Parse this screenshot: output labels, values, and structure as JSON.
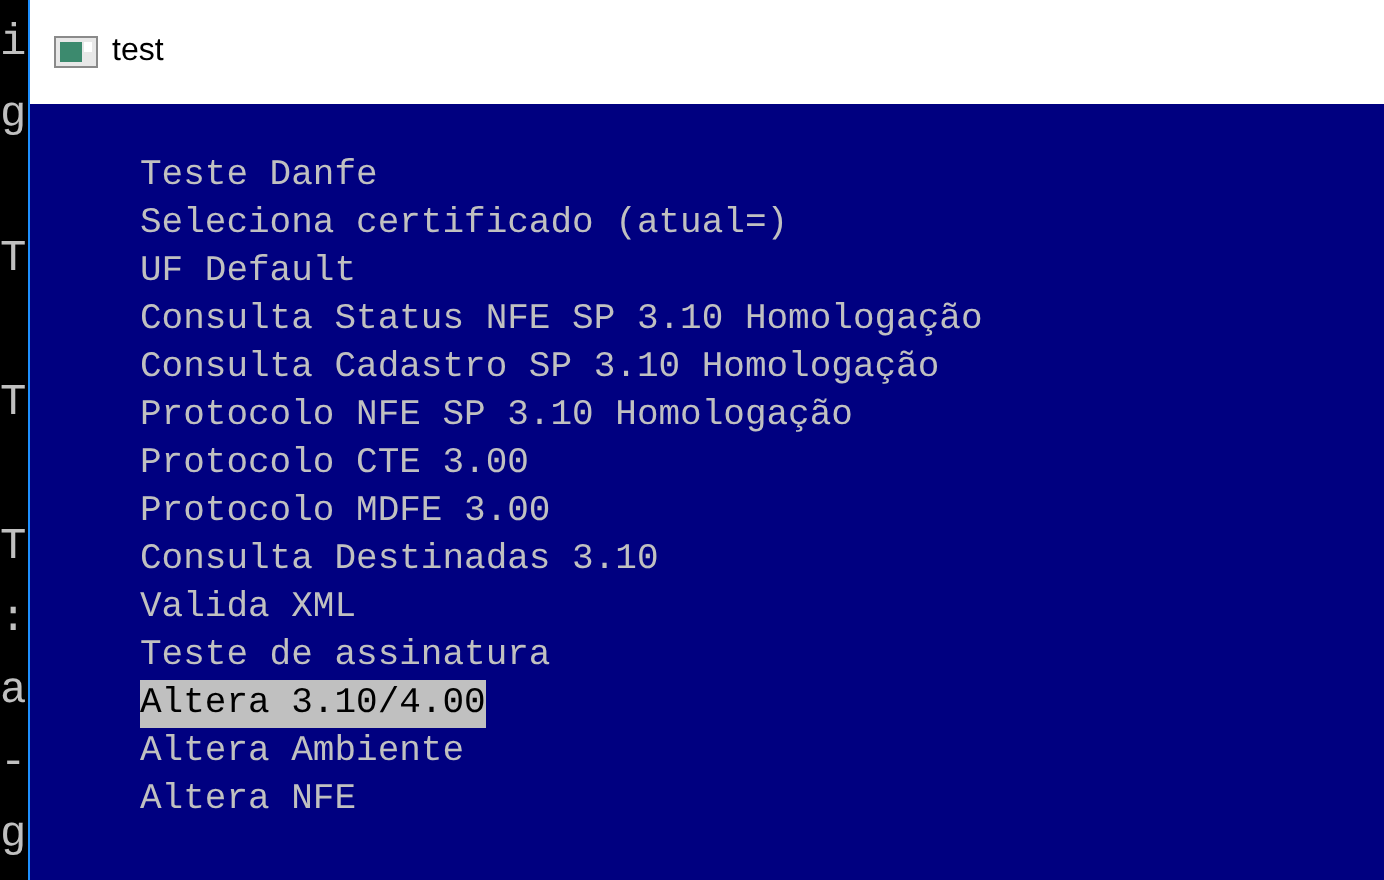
{
  "background_console": {
    "lines": [
      {
        "text": "i",
        "after_blank_line": false
      },
      {
        "text": "g",
        "after_blank_line": false
      },
      {
        "text": "T",
        "after_blank_line": true
      },
      {
        "text": "T",
        "after_blank_line": true
      },
      {
        "text": "T",
        "after_blank_line": true
      },
      {
        "text": ":",
        "after_blank_line": false
      },
      {
        "text": "a",
        "after_blank_line": false
      },
      {
        "text": "-",
        "after_blank_line": false
      },
      {
        "text": "g",
        "after_blank_line": false
      }
    ]
  },
  "window": {
    "title": "test"
  },
  "menu": {
    "items": [
      {
        "label": "Teste Danfe",
        "selected": false
      },
      {
        "label": "Seleciona certificado (atual=)",
        "selected": false
      },
      {
        "label": "UF Default",
        "selected": false
      },
      {
        "label": "Consulta Status NFE SP 3.10 Homologação",
        "selected": false
      },
      {
        "label": "Consulta Cadastro SP 3.10 Homologação",
        "selected": false
      },
      {
        "label": "Protocolo NFE SP 3.10 Homologação",
        "selected": false
      },
      {
        "label": "Protocolo CTE 3.00",
        "selected": false
      },
      {
        "label": "Protocolo MDFE 3.00",
        "selected": false
      },
      {
        "label": "Consulta Destinadas 3.10",
        "selected": false
      },
      {
        "label": "Valida XML",
        "selected": false
      },
      {
        "label": "Teste de assinatura",
        "selected": false
      },
      {
        "label": "Altera 3.10/4.00",
        "selected": true
      },
      {
        "label": "Altera Ambiente",
        "selected": false
      },
      {
        "label": "Altera NFE",
        "selected": false
      }
    ]
  }
}
